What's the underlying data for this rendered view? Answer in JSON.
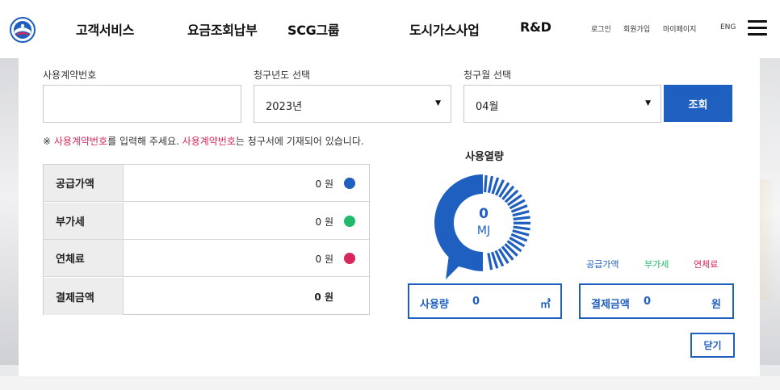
{
  "header": {
    "nav": [
      "고객서비스",
      "요금조회납부",
      "SCG그룹",
      "도시가스사업",
      "R&D"
    ],
    "util": {
      "login": "로그인",
      "join": "회원가입",
      "mypage": "마이페이지",
      "lang": "ENG"
    }
  },
  "form": {
    "contract_label": "사용계약번호",
    "contract_value": "",
    "year_label": "청구년도 선택",
    "year_value": "2023년",
    "month_label": "청구월 선택",
    "month_value": "04월",
    "search_button": "조회"
  },
  "notice": {
    "mark": "※ ",
    "highlight1": "사용계약번호",
    "text1": "를 입력해 주세요. ",
    "highlight2": "사용계약번호",
    "text2": "는 청구서에 기재되어 있습니다."
  },
  "amounts": {
    "rows": [
      {
        "label": "공급가액",
        "value": "0 원",
        "color": "#1f5fbf"
      },
      {
        "label": "부가세",
        "value": "0 원",
        "color": "#21b96a"
      },
      {
        "label": "연체료",
        "value": "0 원",
        "color": "#d6285b"
      },
      {
        "label": "결제금액",
        "value": "0 원"
      }
    ]
  },
  "usage": {
    "title": "사용열량",
    "value": "0",
    "unit": "MJ",
    "legend": [
      {
        "label": "공급가액",
        "color": "#1f5fbf"
      },
      {
        "label": "부가세",
        "color": "#21b96a"
      },
      {
        "label": "연체료",
        "color": "#d6285b"
      }
    ],
    "usage_label": "사용량",
    "usage_value": "0",
    "usage_unit": "㎥",
    "payment_label": "결제금액",
    "payment_value": "0",
    "payment_unit": "원"
  },
  "close_button": "닫기"
}
